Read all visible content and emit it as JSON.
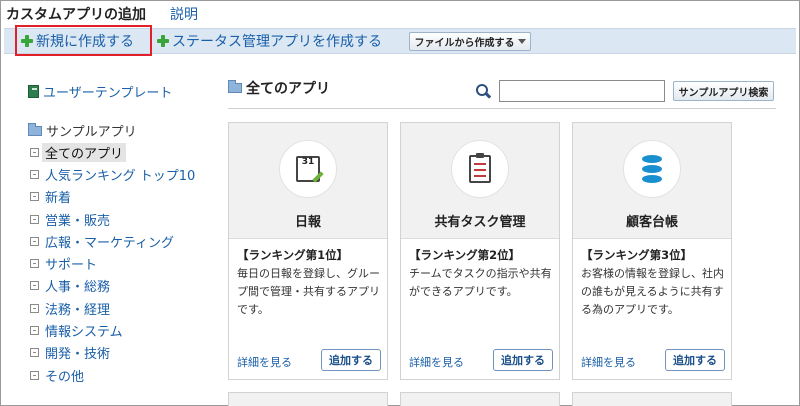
{
  "header": {
    "title": "カスタムアプリの追加",
    "help_label": "説明"
  },
  "toolbar": {
    "new_label": "新規に作成する",
    "status_label": "ステータス管理アプリを作成する",
    "file_label": "ファイルから作成する"
  },
  "sidebar": {
    "template_label": "ユーザーテンプレート",
    "root_label": "サンプルアプリ",
    "items": [
      {
        "label": "全てのアプリ"
      },
      {
        "label": "人気ランキング トップ10"
      },
      {
        "label": "新着"
      },
      {
        "label": "営業・販売"
      },
      {
        "label": "広報・マーケティング"
      },
      {
        "label": "サポート"
      },
      {
        "label": "人事・総務"
      },
      {
        "label": "法務・経理"
      },
      {
        "label": "情報システム"
      },
      {
        "label": "開発・技術"
      },
      {
        "label": "その他"
      }
    ]
  },
  "main": {
    "section_title": "全てのアプリ",
    "search": {
      "value": "",
      "button_label": "サンプルアプリ検索"
    },
    "cards": [
      {
        "name": "日報",
        "rank": "【ランキング第1位】",
        "desc": "毎日の日報を登録し、グループ間で管理・共有するアプリです。",
        "detail_label": "詳細を見る",
        "add_label": "追加する",
        "icon": "calendar-icon",
        "cal_number": "31"
      },
      {
        "name": "共有タスク管理",
        "rank": "【ランキング第2位】",
        "desc": "チームでタスクの指示や共有ができるアプリです。",
        "detail_label": "詳細を見る",
        "add_label": "追加する",
        "icon": "checklist-icon"
      },
      {
        "name": "顧客台帳",
        "rank": "【ランキング第3位】",
        "desc": "お客様の情報を登録し、社内の誰もが見えるように共有する為のアプリです。",
        "detail_label": "詳細を見る",
        "add_label": "追加する",
        "icon": "database-icon"
      }
    ]
  },
  "colors": {
    "accent": "#1a5fa8",
    "toolbar_bg": "#dbe7f3",
    "highlight_border": "#e2202a",
    "plus": "#3aa53a"
  }
}
